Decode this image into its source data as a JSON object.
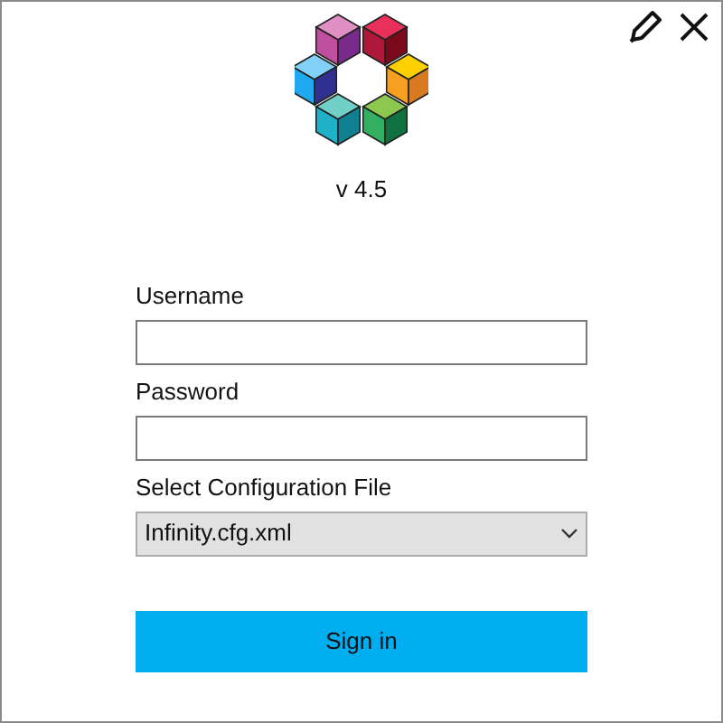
{
  "version": "v 4.5",
  "fields": [
    {
      "label": "Username",
      "kind": "text"
    },
    {
      "label": "Password",
      "kind": "password"
    },
    {
      "label": "Select Configuration File",
      "kind": "select",
      "value": "Infinity.cfg.xml"
    }
  ],
  "button": "Sign in"
}
